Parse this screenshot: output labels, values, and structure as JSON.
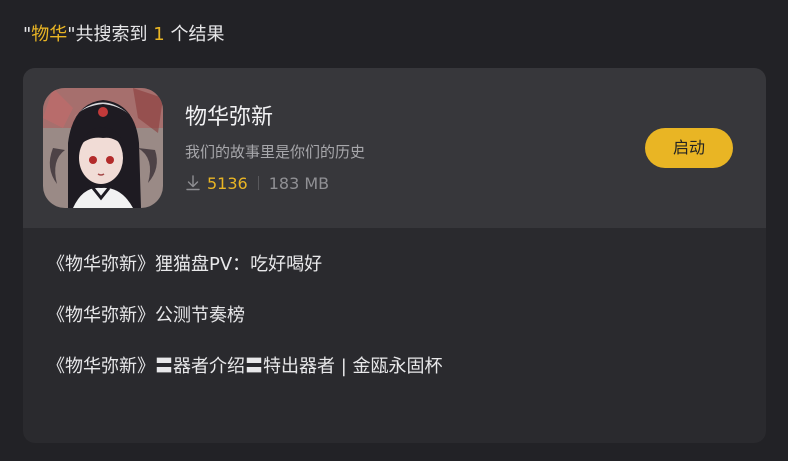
{
  "search_summary": {
    "open_quote": "\"",
    "keyword": "物华",
    "close_quote_and_text": "\"共搜索到 ",
    "count": "1",
    "suffix": " 个结果"
  },
  "app": {
    "name": "物华弥新",
    "slogan": "我们的故事里是你们的历史",
    "downloads": "5136",
    "size": "183 MB",
    "launch_label": "启动",
    "icon": "app-character-icon",
    "download_icon": "download-icon"
  },
  "news": [
    "《物华弥新》狸猫盘PV：吃好喝好",
    "《物华弥新》公测节奏榜",
    "《物华弥新》〓器者介绍〓特出器者 | 金瓯永固杯"
  ],
  "colors": {
    "accent": "#e9b524",
    "background": "#222226",
    "card": "#2a2a2e",
    "app_row": "#37373b"
  }
}
